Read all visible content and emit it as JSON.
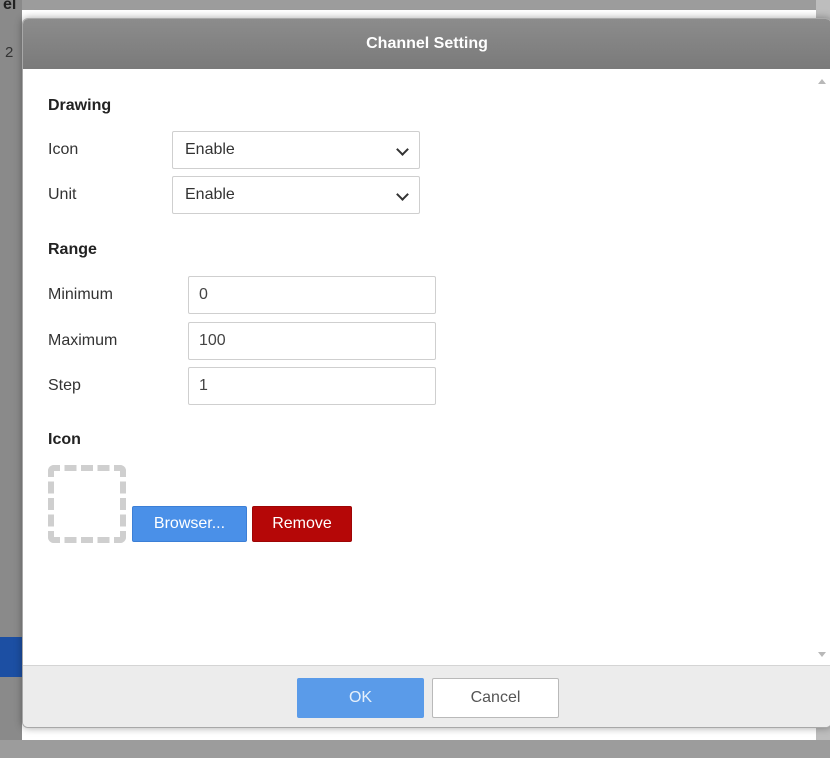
{
  "background": {
    "fragment_top": "el",
    "fragment_mid": "2"
  },
  "dialog": {
    "title": "Channel Setting"
  },
  "drawing": {
    "section_title": "Drawing",
    "icon_label": "Icon",
    "icon_value": "Enable",
    "unit_label": "Unit",
    "unit_value": "Enable"
  },
  "range": {
    "section_title": "Range",
    "minimum_label": "Minimum",
    "minimum_value": "0",
    "maximum_label": "Maximum",
    "maximum_value": "100",
    "step_label": "Step",
    "step_value": "1"
  },
  "icon_section": {
    "section_title": "Icon",
    "browse_label": "Browser...",
    "remove_label": "Remove"
  },
  "footer": {
    "ok_label": "OK",
    "cancel_label": "Cancel"
  },
  "colors": {
    "header_bg": "#808080",
    "browse_bg": "#4a90e8",
    "remove_bg": "#b50707",
    "ok_bg": "#5a9be9"
  }
}
